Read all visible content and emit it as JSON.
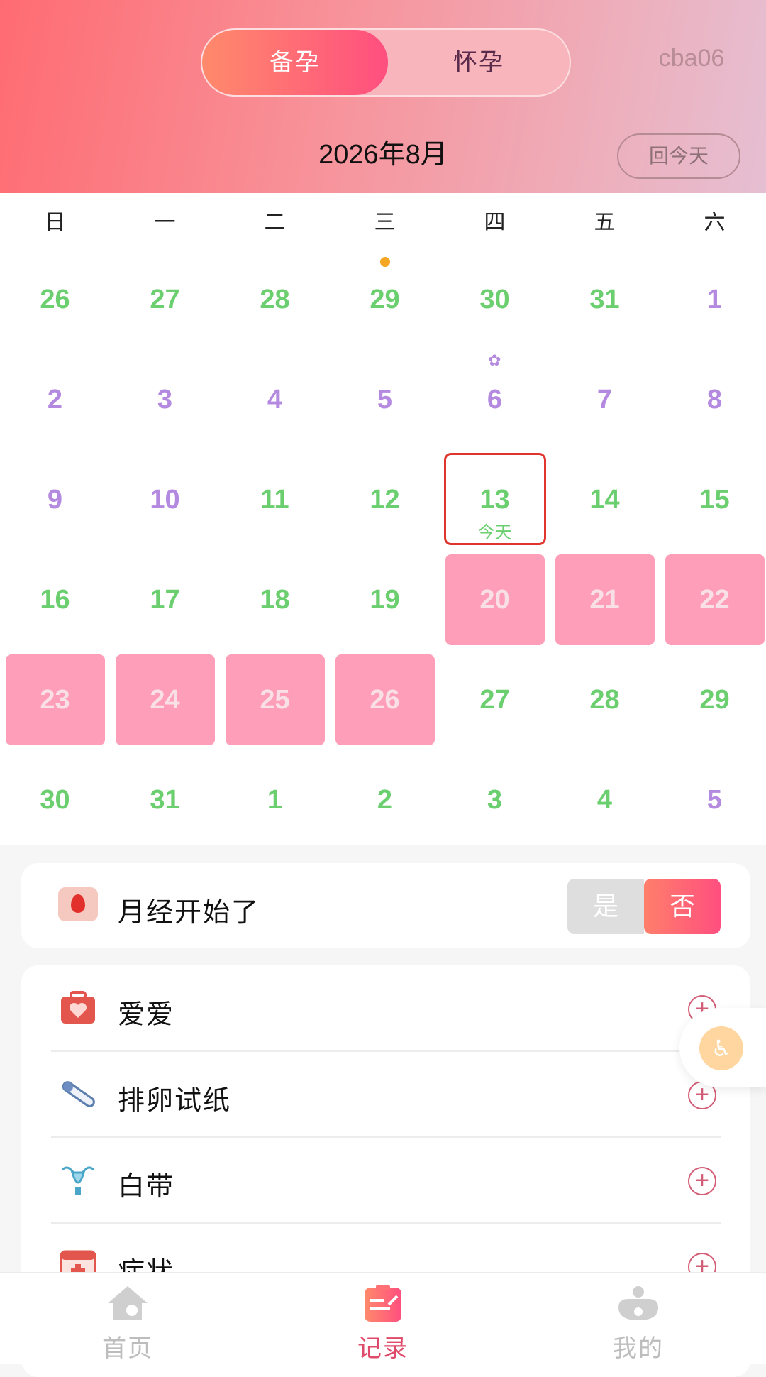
{
  "header": {
    "segments": [
      "备孕",
      "怀孕"
    ],
    "active_segment": 0,
    "username": "cba06",
    "month_title": "2026年8月",
    "today_button": "回今天"
  },
  "calendar": {
    "weekdays": [
      "日",
      "一",
      "二",
      "三",
      "四",
      "五",
      "六"
    ],
    "today_label": "今天",
    "weeks": [
      [
        {
          "d": "26",
          "c": "green"
        },
        {
          "d": "27",
          "c": "green"
        },
        {
          "d": "28",
          "c": "green"
        },
        {
          "d": "29",
          "c": "green",
          "mark": "dot"
        },
        {
          "d": "30",
          "c": "green"
        },
        {
          "d": "31",
          "c": "green"
        },
        {
          "d": "1",
          "c": "purple"
        }
      ],
      [
        {
          "d": "2",
          "c": "purple"
        },
        {
          "d": "3",
          "c": "purple"
        },
        {
          "d": "4",
          "c": "purple"
        },
        {
          "d": "5",
          "c": "purple"
        },
        {
          "d": "6",
          "c": "purple",
          "mark": "flower"
        },
        {
          "d": "7",
          "c": "purple"
        },
        {
          "d": "8",
          "c": "purple"
        }
      ],
      [
        {
          "d": "9",
          "c": "purple"
        },
        {
          "d": "10",
          "c": "purple"
        },
        {
          "d": "11",
          "c": "green"
        },
        {
          "d": "12",
          "c": "green"
        },
        {
          "d": "13",
          "c": "green",
          "today": true
        },
        {
          "d": "14",
          "c": "green"
        },
        {
          "d": "15",
          "c": "green"
        }
      ],
      [
        {
          "d": "16",
          "c": "green"
        },
        {
          "d": "17",
          "c": "green"
        },
        {
          "d": "18",
          "c": "green"
        },
        {
          "d": "19",
          "c": "green"
        },
        {
          "d": "20",
          "c": "period"
        },
        {
          "d": "21",
          "c": "period"
        },
        {
          "d": "22",
          "c": "period"
        }
      ],
      [
        {
          "d": "23",
          "c": "period"
        },
        {
          "d": "24",
          "c": "period"
        },
        {
          "d": "25",
          "c": "period"
        },
        {
          "d": "26",
          "c": "period"
        },
        {
          "d": "27",
          "c": "green"
        },
        {
          "d": "28",
          "c": "green"
        },
        {
          "d": "29",
          "c": "green"
        }
      ],
      [
        {
          "d": "30",
          "c": "green"
        },
        {
          "d": "31",
          "c": "green"
        },
        {
          "d": "1",
          "c": "green"
        },
        {
          "d": "2",
          "c": "green"
        },
        {
          "d": "3",
          "c": "green"
        },
        {
          "d": "4",
          "c": "green"
        },
        {
          "d": "5",
          "c": "purple"
        }
      ]
    ]
  },
  "period_card": {
    "label": "月经开始了",
    "yes": "是",
    "no": "否",
    "selected": "否"
  },
  "records": [
    {
      "label": "爱爱",
      "icon": "medical-kit-heart-icon"
    },
    {
      "label": "排卵试纸",
      "icon": "ovulation-test-strip-icon"
    },
    {
      "label": "白带",
      "icon": "uterus-icon"
    },
    {
      "label": "症状",
      "icon": "calendar-cross-icon"
    }
  ],
  "tabbar": {
    "tabs": [
      {
        "label": "首页",
        "icon": "home-icon",
        "active": false
      },
      {
        "label": "记录",
        "icon": "record-icon",
        "active": true
      },
      {
        "label": "我的",
        "icon": "profile-icon",
        "active": false
      }
    ]
  },
  "colors": {
    "green_day": "#6ccf6f",
    "purple_day": "#b489e0",
    "period_fill": "#ff9eb8",
    "today_border": "#e0352f",
    "accent": "#ff4f7f"
  }
}
